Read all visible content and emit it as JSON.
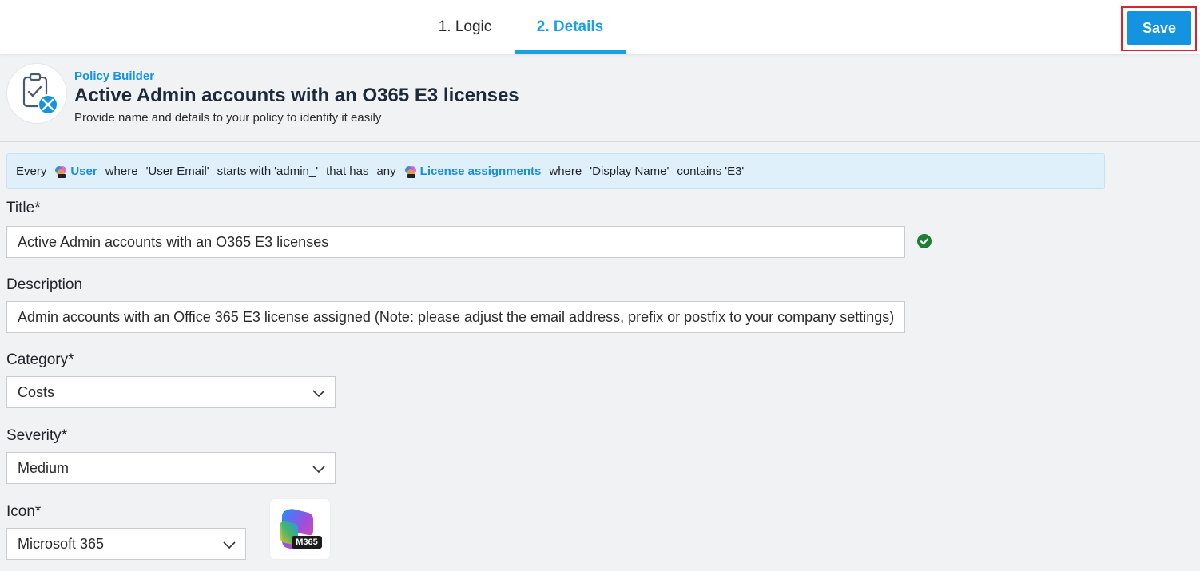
{
  "tabs": [
    {
      "label": "1. Logic"
    },
    {
      "label": "2. Details"
    }
  ],
  "toolbar": {
    "save_label": "Save"
  },
  "header": {
    "breadcrumb": "Policy Builder",
    "title": "Active Admin accounts with an O365 E3 licenses",
    "subtitle": "Provide name and details to your policy to identify it easily",
    "icon": "policy-builder-icon"
  },
  "summary": {
    "every": "Every",
    "entity1": "User",
    "where1": "where",
    "field1": "'User Email'",
    "op1": "starts with",
    "value1": "'admin_'",
    "that_has": "that has",
    "any": "any",
    "entity2": "License assignments",
    "where2": "where",
    "field2": "'Display Name'",
    "op2": "contains",
    "value2": "'E3'"
  },
  "form": {
    "title_label": "Title*",
    "title_value": "Active Admin accounts with an O365 E3 licenses",
    "description_label": "Description",
    "description_value": "Admin accounts with an Office 365 E3 license assigned (Note: please adjust the email address, prefix or postfix to your company settings)",
    "category_label": "Category*",
    "category_value": "Costs",
    "severity_label": "Severity*",
    "severity_value": "Medium",
    "icon_label": "Icon*",
    "icon_value": "Microsoft 365",
    "icon_preview_text": "M365"
  },
  "colors": {
    "accent": "#1ba1e2",
    "save": "#1494e0",
    "highlight": "#d9232d",
    "valid": "#1e7e34",
    "banner": "#dff0fb"
  }
}
